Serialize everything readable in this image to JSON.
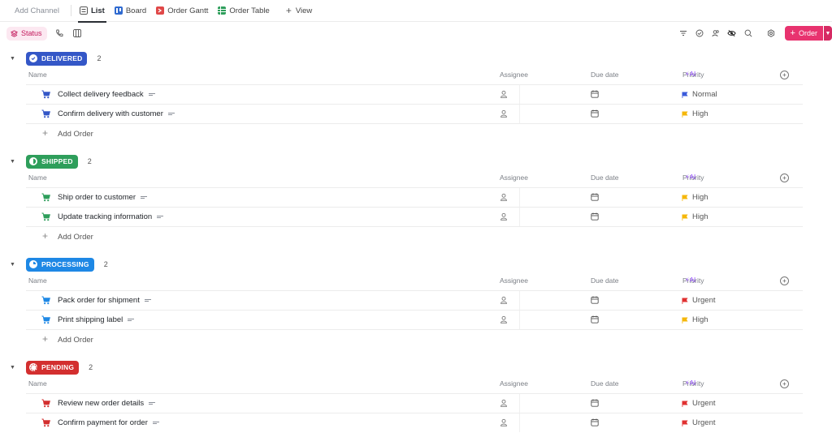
{
  "tabs": {
    "add_channel": "Add Channel",
    "items": [
      {
        "label": "List",
        "icon": "list-icon",
        "color": "#555555"
      },
      {
        "label": "Board",
        "icon": "board-icon",
        "color": "#2f6ad0"
      },
      {
        "label": "Order Gantt",
        "icon": "gantt-icon",
        "color": "#e04848"
      },
      {
        "label": "Order Table",
        "icon": "table-icon",
        "color": "#2e9e5b"
      }
    ],
    "add_view": "View"
  },
  "toolbar": {
    "status_label": "Status",
    "order_button": "Order"
  },
  "columns": {
    "name": "Name",
    "assignee": "Assignee",
    "due_date": "Due date",
    "priority": "Priority",
    "ai": "AI"
  },
  "add_order_label": "Add Order",
  "groups": [
    {
      "status": "DELIVERED",
      "color": "#3457c7",
      "count": "2",
      "tasks": [
        {
          "name": "Collect delivery feedback",
          "priority": "Normal",
          "flag_color": "#3b5bdb"
        },
        {
          "name": "Confirm delivery with customer",
          "priority": "High",
          "flag_color": "#f5b70a"
        }
      ]
    },
    {
      "status": "SHIPPED",
      "color": "#2e9e5b",
      "count": "2",
      "tasks": [
        {
          "name": "Ship order to customer",
          "priority": "High",
          "flag_color": "#f5b70a"
        },
        {
          "name": "Update tracking information",
          "priority": "High",
          "flag_color": "#f5b70a"
        }
      ]
    },
    {
      "status": "PROCESSING",
      "color": "#1e88e5",
      "count": "2",
      "tasks": [
        {
          "name": "Pack order for shipment",
          "priority": "Urgent",
          "flag_color": "#e03131"
        },
        {
          "name": "Print shipping label",
          "priority": "High",
          "flag_color": "#f5b70a"
        }
      ]
    },
    {
      "status": "PENDING",
      "color": "#d32f2f",
      "count": "2",
      "tasks": [
        {
          "name": "Review new order details",
          "priority": "Urgent",
          "flag_color": "#e03131"
        },
        {
          "name": "Confirm payment for order",
          "priority": "Urgent",
          "flag_color": "#e03131"
        }
      ]
    }
  ]
}
